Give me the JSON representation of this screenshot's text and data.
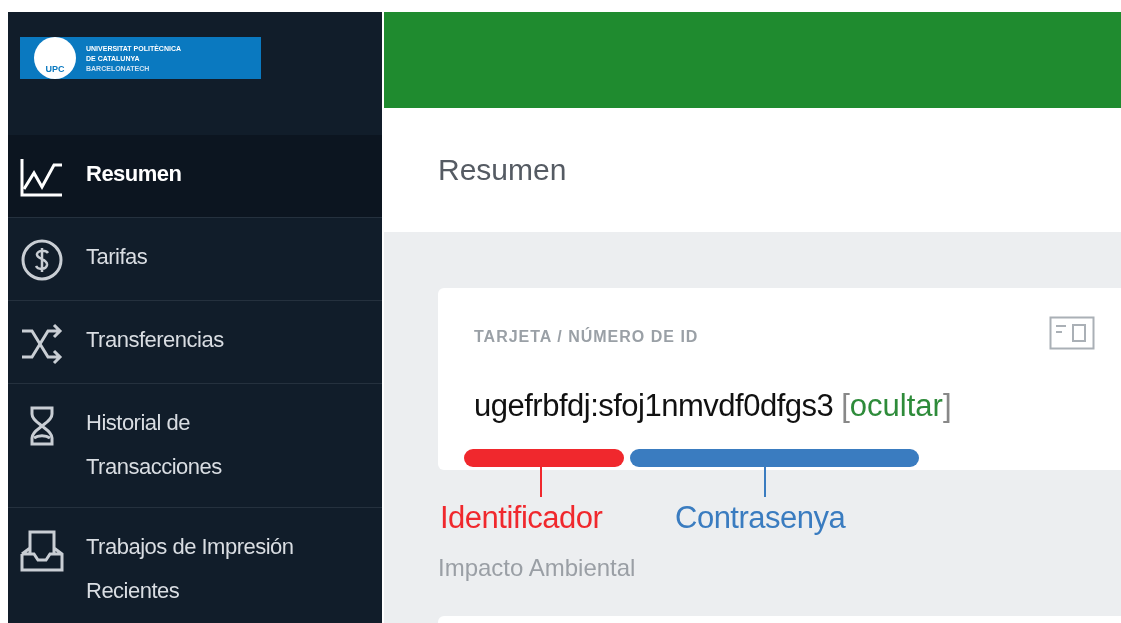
{
  "logo": {
    "badge": "UPC",
    "lines": [
      "UNIVERSITAT POLITÈCNICA",
      "DE CATALUNYA",
      "BARCELONATECH"
    ]
  },
  "sidebar": {
    "items": [
      {
        "label": "Resumen",
        "selected": true
      },
      {
        "label": "Tarifas",
        "selected": false
      },
      {
        "label": "Transferencias",
        "selected": false
      },
      {
        "label": "Historial de Transacciones",
        "selected": false
      },
      {
        "label": "Trabajos de Impresión Recientes",
        "selected": false
      }
    ]
  },
  "page_title": "Resumen",
  "card": {
    "label": "TARJETA / NÚMERO DE ID",
    "value": "ugefrbfdj:sfoj1nmvdf0dfgs3",
    "toggle": {
      "open": "[",
      "label": "ocultar",
      "close": "]"
    }
  },
  "annotations": [
    {
      "label": "Identificador",
      "color": "#f0282d"
    },
    {
      "label": "Contrasenya",
      "color": "#3a7cc0"
    }
  ],
  "section_title": "Impacto Ambiental"
}
